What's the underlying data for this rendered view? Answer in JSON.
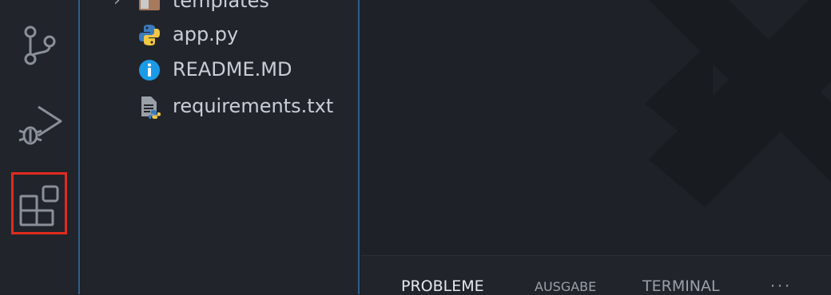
{
  "explorer": {
    "items": [
      {
        "label": "templates",
        "icon": "folder-icon",
        "chevron": "›"
      },
      {
        "label": "app.py",
        "icon": "python-file-icon"
      },
      {
        "label": "README.MD",
        "icon": "info-icon"
      },
      {
        "label": "requirements.txt",
        "icon": "requirements-file-icon"
      }
    ]
  },
  "activity_bar": {
    "items": [
      "source-control-icon",
      "run-debug-icon",
      "extensions-icon"
    ],
    "highlighted": "extensions-icon"
  },
  "panel": {
    "tabs": [
      {
        "label": "PROBLEME",
        "active": true
      },
      {
        "label": "AUSGABE",
        "active": false
      },
      {
        "label": "TERMINAL",
        "active": false
      }
    ],
    "more_label": "···"
  },
  "colors": {
    "highlight": "#e02b20",
    "accent_border": "#2f5d8f",
    "python_blue": "#3b7bbf",
    "python_yellow": "#f2c744",
    "info_blue": "#1a9be8"
  }
}
